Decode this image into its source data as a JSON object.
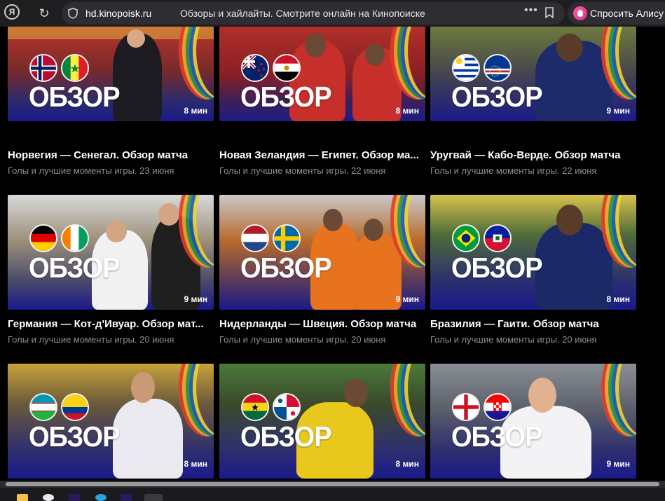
{
  "browser": {
    "domain": "hd.kinopoisk.ru",
    "page_title": "Обзоры и хайлайты. Смотрите онлайн на Кинопоиске",
    "alice_label": "Спросить Алису",
    "menu_dots": "•••",
    "yandex_letter": "Я"
  },
  "cards": [
    {
      "title": "Норвегия — Сенегал. Обзор матча",
      "subtitle": "Голы и лучшие моменты игры. 23 июня",
      "badge": "ОБЗОР",
      "duration": "8 мин",
      "flags": [
        "norway",
        "senegal"
      ]
    },
    {
      "title": "Новая Зеландия — Египет. Обзор ма...",
      "subtitle": "Голы и лучшие моменты игры. 22 июня",
      "badge": "ОБЗОР",
      "duration": "8 мин",
      "flags": [
        "new-zealand",
        "egypt"
      ]
    },
    {
      "title": "Уругвай — Кабо-Верде. Обзор матча",
      "subtitle": "Голы и лучшие моменты игры. 22 июня",
      "badge": "ОБЗОР",
      "duration": "9 мин",
      "flags": [
        "uruguay",
        "cape-verde"
      ]
    },
    {
      "title": "Германия — Кот-д'Ивуар. Обзор мат...",
      "subtitle": "Голы и лучшие моменты игры. 20 июня",
      "badge": "ОБЗОР",
      "duration": "9 мин",
      "flags": [
        "germany",
        "ivory-coast"
      ]
    },
    {
      "title": "Нидерланды — Швеция. Обзор матча",
      "subtitle": "Голы и лучшие моменты игры. 20 июня",
      "badge": "ОБЗОР",
      "duration": "9 мин",
      "flags": [
        "netherlands",
        "sweden"
      ]
    },
    {
      "title": "Бразилия — Гаити. Обзор матча",
      "subtitle": "Голы и лучшие моменты игры. 20 июня",
      "badge": "ОБЗОР",
      "duration": "8 мин",
      "flags": [
        "brazil",
        "haiti"
      ]
    },
    {
      "title": "",
      "subtitle": "",
      "badge": "ОБЗОР",
      "duration": "8 мин",
      "flags": [
        "uzbekistan",
        "colombia"
      ]
    },
    {
      "title": "",
      "subtitle": "",
      "badge": "ОБЗОР",
      "duration": "8 мин",
      "flags": [
        "ghana",
        "panama"
      ]
    },
    {
      "title": "",
      "subtitle": "",
      "badge": "ОБЗОР",
      "duration": "9 мин",
      "flags": [
        "england",
        "croatia"
      ]
    }
  ],
  "colors": {
    "page_bg": "#000000",
    "card_title": "#ffffff",
    "card_subtitle": "#8d8d8d",
    "topbar_bg": "#1f1f22"
  }
}
